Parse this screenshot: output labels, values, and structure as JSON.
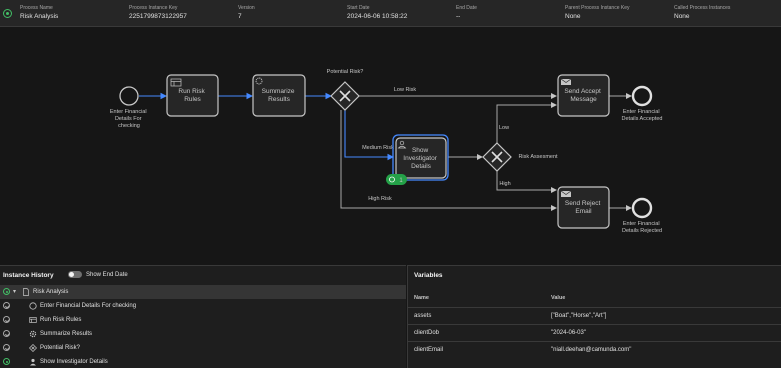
{
  "header": {
    "fields": [
      {
        "label": "Process Name",
        "value": "Risk Analysis"
      },
      {
        "label": "Process Instance Key",
        "value": "2251799873122957"
      },
      {
        "label": "Version",
        "value": "7"
      },
      {
        "label": "Start Date",
        "value": "2024-06-06 10:58:22"
      },
      {
        "label": "End Date",
        "value": "--"
      },
      {
        "label": "Parent Process Instance Key",
        "value": "None"
      },
      {
        "label": "Called Process Instances",
        "value": "None"
      }
    ]
  },
  "diagram": {
    "start_event": "Enter Financial Details For checking",
    "tasks": {
      "run_risk_rules": "Run Risk Rules",
      "summarize_results": "Summarize Results",
      "show_investigator": "Show Investigator Details",
      "send_accept": "Send Accept Message",
      "send_reject": "Send Reject Email"
    },
    "gateways": {
      "potential_risk": "Potential Risk?",
      "risk_assesment": "Risk Assesment"
    },
    "flows": {
      "low_risk": "Low Risk",
      "medium_risk": "Medium Risk",
      "high_risk": "High Risk",
      "low": "Low",
      "high": "High"
    },
    "end_events": {
      "accepted": "Enter Financial Details Accepted",
      "rejected": "Enter Financial Details Rejected"
    },
    "token_count": "1",
    "colors": {
      "active": "#4589ff",
      "token": "#24a148"
    }
  },
  "history": {
    "title": "Instance History",
    "toggle_label": "Show End Date",
    "items": [
      {
        "label": "Risk Analysis",
        "icon": "document-icon"
      },
      {
        "label": "Enter Financial Details For checking",
        "icon": "start-event-icon"
      },
      {
        "label": "Run Risk Rules",
        "icon": "business-rule-icon"
      },
      {
        "label": "Summarize Results",
        "icon": "service-task-icon"
      },
      {
        "label": "Potential Risk?",
        "icon": "gateway-icon"
      },
      {
        "label": "Show Investigator Details",
        "icon": "user-task-icon"
      }
    ]
  },
  "variables": {
    "title": "Variables",
    "col_name": "Name",
    "col_value": "Value",
    "rows": [
      {
        "name": "assets",
        "value": "[\"Boat\",\"Horse\",\"Art\"]"
      },
      {
        "name": "clientDob",
        "value": "\"2024-06-03\""
      },
      {
        "name": "clientEmail",
        "value": "\"niall.deehan@camunda.com\""
      }
    ]
  }
}
